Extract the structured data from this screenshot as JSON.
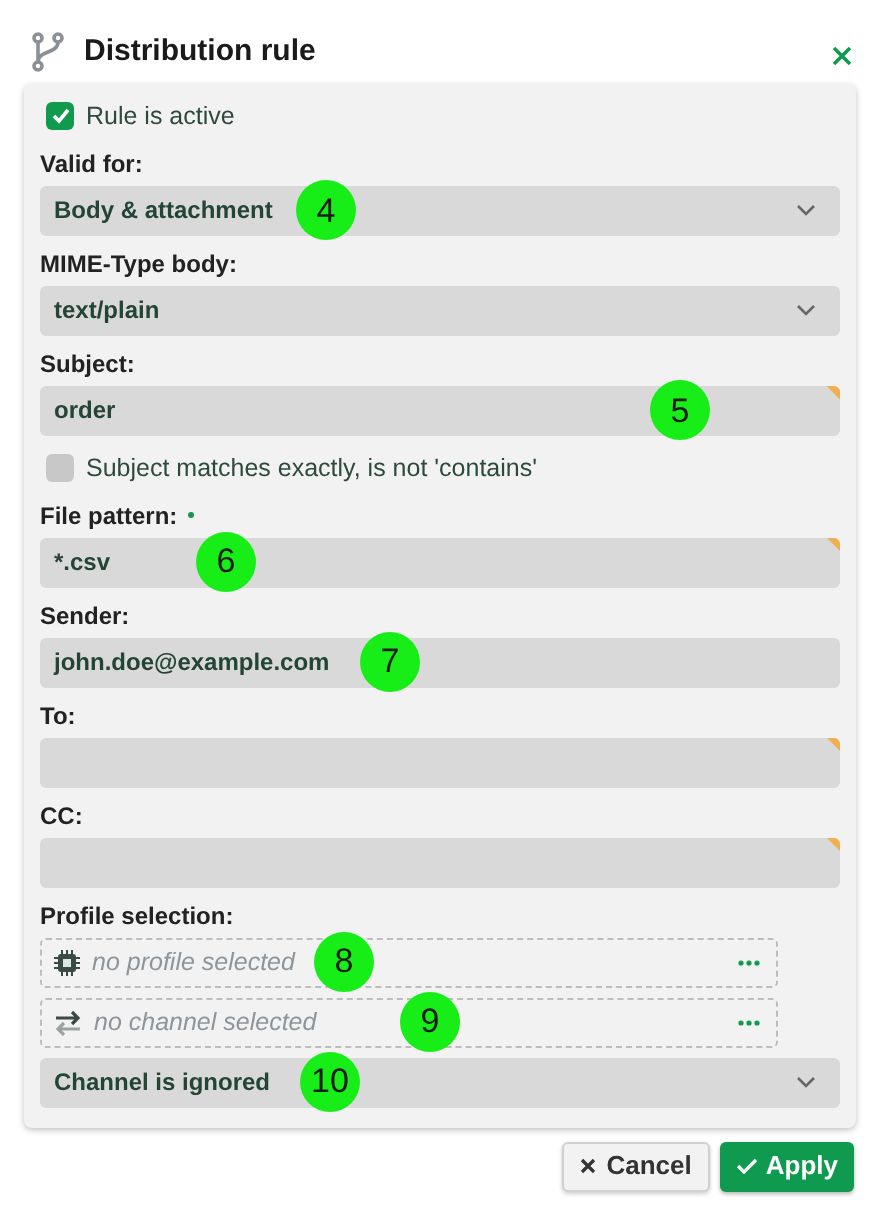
{
  "dialog": {
    "title": "Distribution rule"
  },
  "fields": [
    {
      "kind": "checkbox",
      "label": "Rule is active",
      "checked": true
    },
    {
      "kind": "select",
      "label": "Valid for:",
      "value": "Body & attachment",
      "callout": "4"
    },
    {
      "kind": "select",
      "label": "MIME-Type body:",
      "value": "text/plain"
    },
    {
      "kind": "text",
      "label": "Subject:",
      "value": "order",
      "flagged": true,
      "callout": "5"
    },
    {
      "kind": "checkbox",
      "label": "Subject matches exactly, is not 'contains'",
      "checked": false
    },
    {
      "kind": "text",
      "label": "File pattern:",
      "required": true,
      "value": "*.csv",
      "flagged": true,
      "callout": "6"
    },
    {
      "kind": "text",
      "label": "Sender:",
      "value": "john.doe@example.com",
      "callout": "7"
    },
    {
      "kind": "text",
      "label": "To:",
      "flagged": true
    },
    {
      "kind": "text",
      "label": "CC:",
      "flagged": true
    },
    {
      "kind": "heading",
      "label": "Profile selection:"
    },
    {
      "kind": "picker",
      "placeholder": "no profile selected",
      "callout": "8"
    },
    {
      "kind": "picker",
      "placeholder": "no channel selected",
      "callout": "9"
    },
    {
      "kind": "select",
      "value": "Channel is ignored",
      "callout": "10"
    }
  ],
  "buttons": [
    {
      "kind": "cancel",
      "label": "Cancel"
    },
    {
      "kind": "apply",
      "label": "Apply"
    }
  ]
}
